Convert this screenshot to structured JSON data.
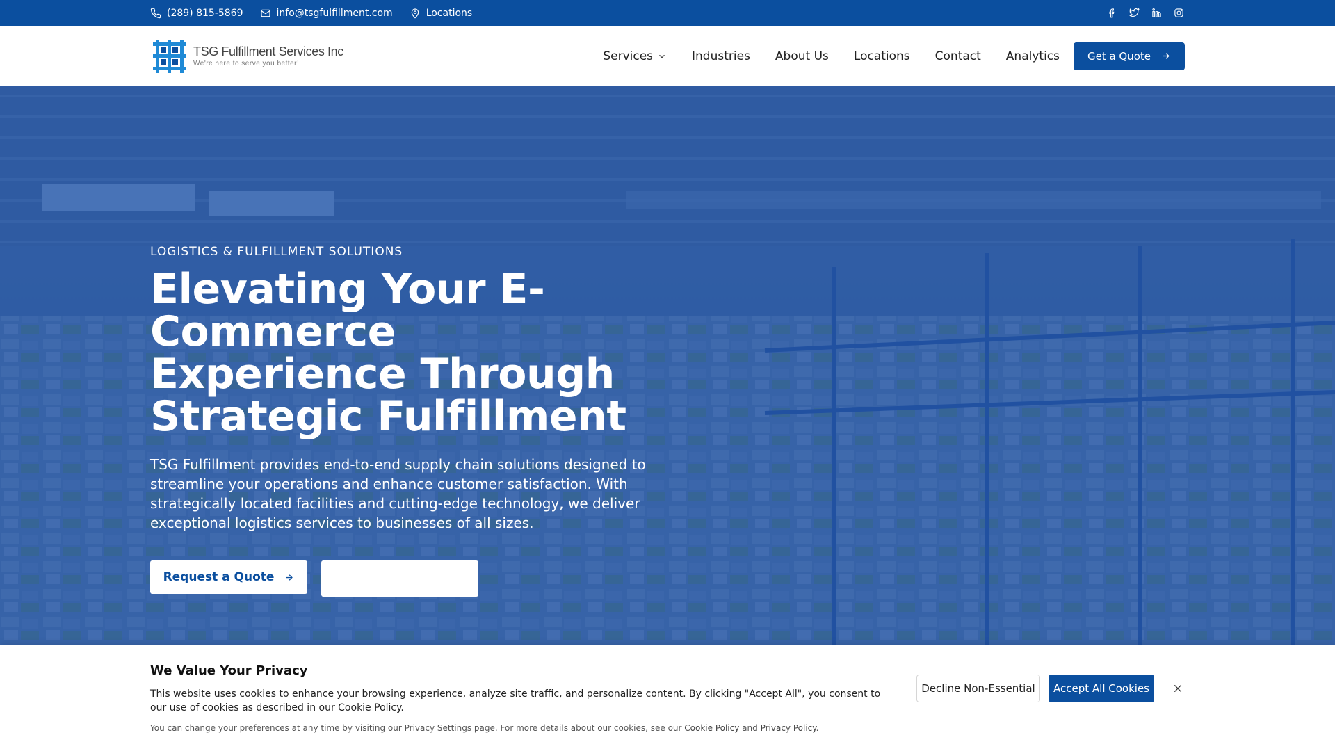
{
  "topbar": {
    "phone": "(289) 815-5869",
    "email": "info@tsgfulfillment.com",
    "locations": "Locations",
    "socials": [
      "facebook-icon",
      "twitter-icon",
      "linkedin-icon",
      "instagram-icon"
    ]
  },
  "header": {
    "logo_name": "TSG Fulfillment Services Inc",
    "logo_tagline": "We're here to serve you better!",
    "nav": [
      "Services",
      "Industries",
      "About Us",
      "Locations",
      "Contact",
      "Analytics"
    ],
    "cta": "Get a Quote"
  },
  "hero": {
    "eyebrow": "LOGISTICS & FULFILLMENT SOLUTIONS",
    "headline": [
      "Elevating Your E-Commerce",
      "Experience Through",
      "Strategic Fulfillment"
    ],
    "lead": "TSG Fulfillment provides end-to-end supply chain solutions designed to streamline your operations and enhance customer satisfaction. With strategically located facilities and cutting-edge technology, we deliver exceptional logistics services to businesses of all sizes.",
    "primary_button": "Request a Quote",
    "secondary_button": ""
  },
  "cookie": {
    "title": "We Value Your Privacy",
    "text": "This website uses cookies to enhance your browsing experience, analyze site traffic, and personalize content. By clicking \"Accept All\", you consent to our use of cookies as described in our Cookie Policy.",
    "small_prefix": "You can change your preferences at any time by visiting our Privacy Settings page. For more details about our cookies, see our",
    "cookie_policy_link": "Cookie Policy",
    "and": "and",
    "privacy_policy_link": "Privacy Policy",
    "decline": "Decline Non-Essential",
    "accept": "Accept All Cookies"
  },
  "colors": {
    "brand_blue": "#0b4f9f",
    "hero_overlay": "#164ea8",
    "white": "#ffffff"
  }
}
